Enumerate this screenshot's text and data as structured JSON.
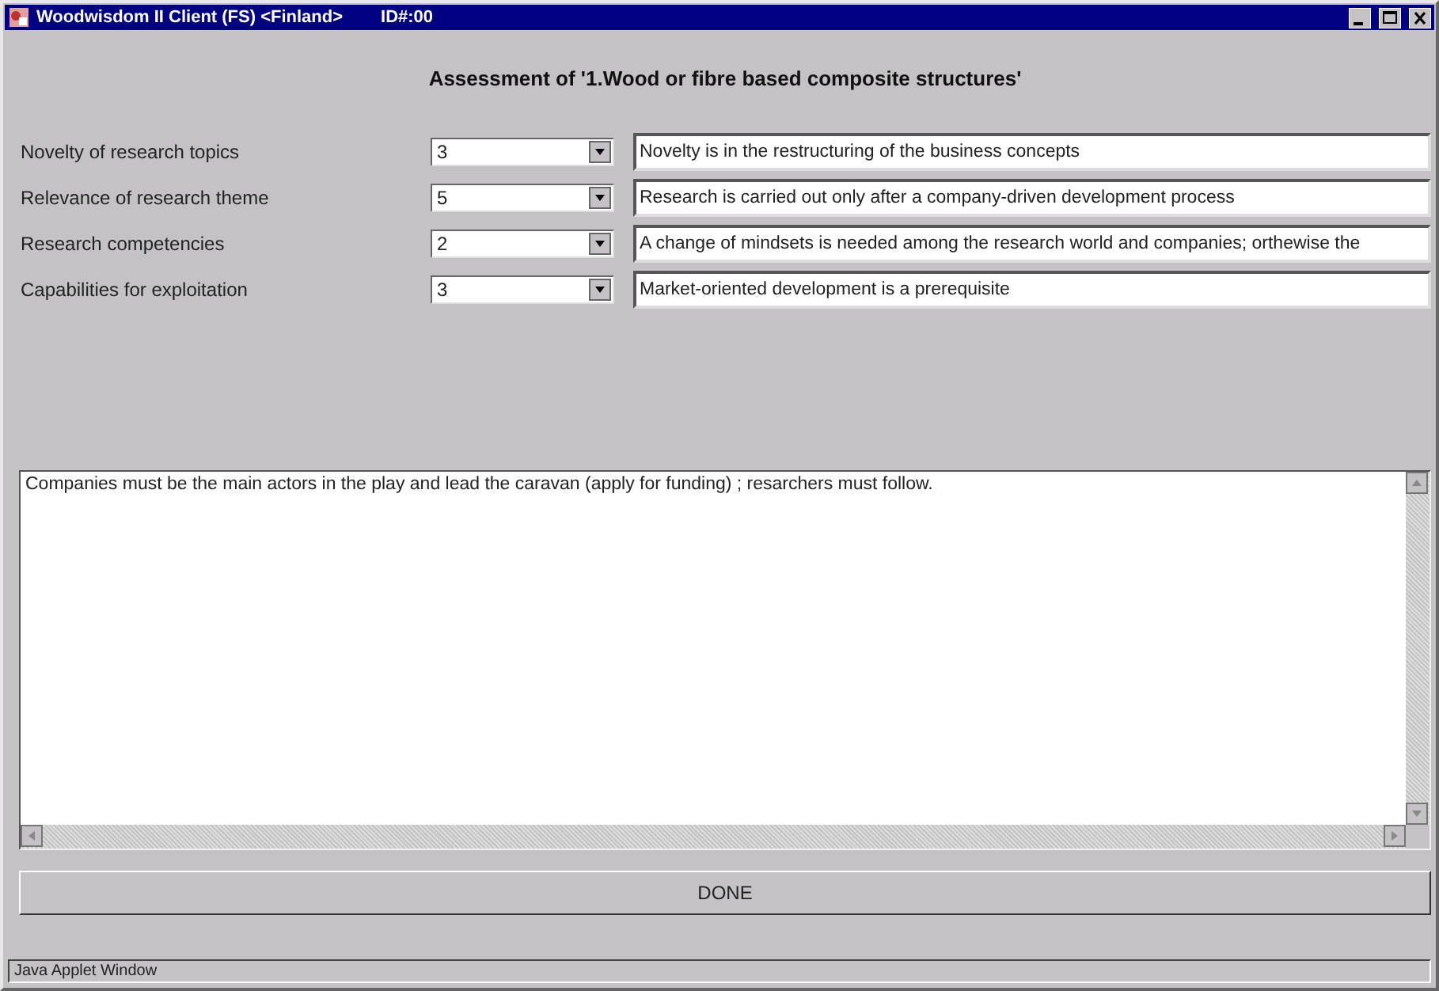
{
  "window": {
    "title": "Woodwisdom II Client (FS) <Finland>",
    "id_label": "ID#:00"
  },
  "heading": "Assessment of '1.Wood or fibre based composite structures'",
  "criteria": [
    {
      "label": "Novelty of research topics",
      "score": "3",
      "comment": "Novelty is in the restructuring of the business concepts"
    },
    {
      "label": "Relevance of research theme",
      "score": "5",
      "comment": "Research is carried out only after a company-driven development process"
    },
    {
      "label": "Research competencies",
      "score": "2",
      "comment": "A change of mindsets is needed among the research world and companies; orthewise the"
    },
    {
      "label": "Capabilities for exploitation",
      "score": "3",
      "comment": "Market-oriented development is a prerequisite"
    }
  ],
  "summary": "Companies must be the main actors in the play and lead the caravan (apply for funding) ; resarchers must follow.",
  "done_button": "DONE",
  "status_bar": "Java Applet Window"
}
